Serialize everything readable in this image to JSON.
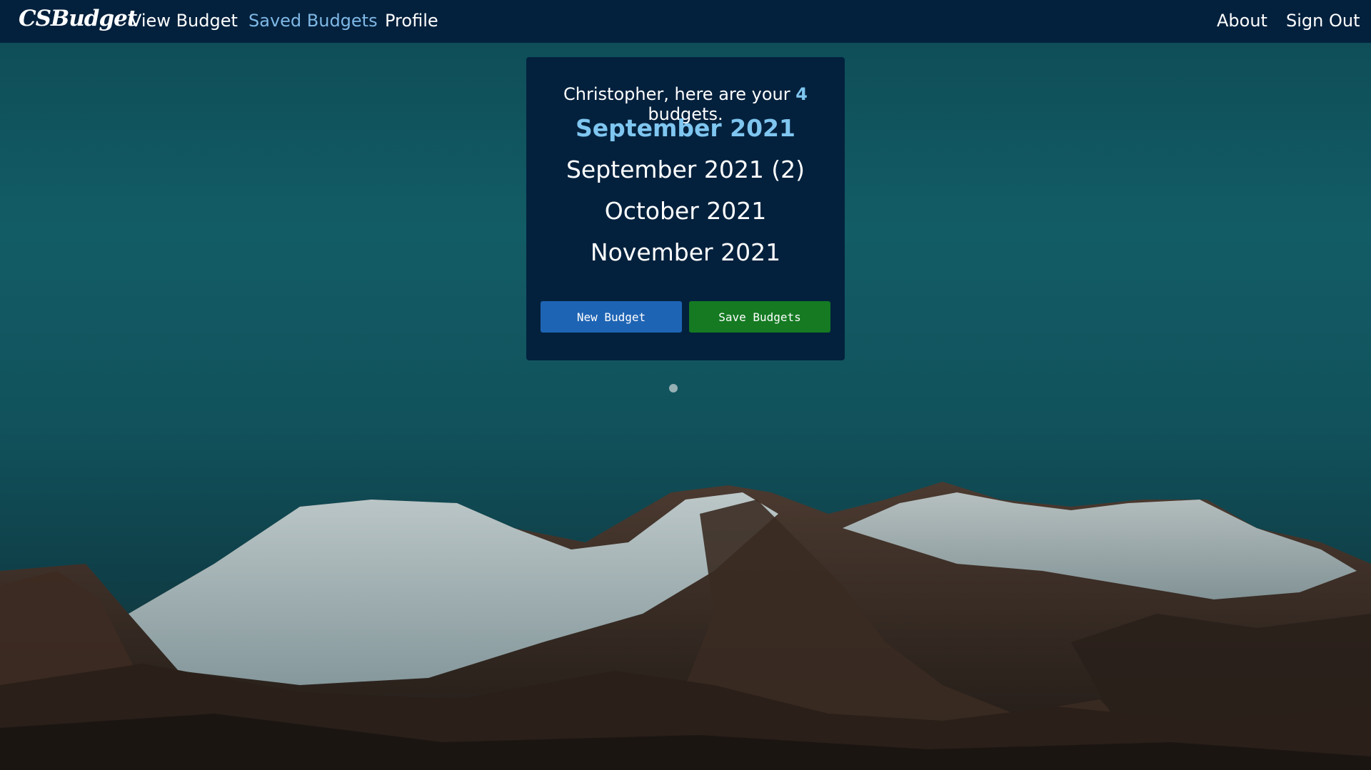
{
  "navbar": {
    "brand": "CSBudget",
    "links": [
      {
        "label": "View Budget",
        "active": false
      },
      {
        "label": "Saved Budgets",
        "active": true
      },
      {
        "label": "Profile",
        "active": false
      }
    ],
    "right_links": [
      {
        "label": "About"
      },
      {
        "label": "Sign Out"
      }
    ]
  },
  "card": {
    "greeting_prefix": "Christopher, here are your ",
    "budget_count": "4",
    "greeting_suffix": " budgets.",
    "budgets": [
      {
        "label": "September 2021",
        "selected": true
      },
      {
        "label": "September 2021 (2)",
        "selected": false
      },
      {
        "label": "October 2021",
        "selected": false
      },
      {
        "label": "November 2021",
        "selected": false
      }
    ],
    "new_budget_label": "New Budget",
    "save_budgets_label": "Save Budgets"
  },
  "colors": {
    "navbar_bg": "#03213d",
    "accent_link": "#7fb8e6",
    "primary_button": "#1e64b4",
    "success_button": "#157a22"
  }
}
